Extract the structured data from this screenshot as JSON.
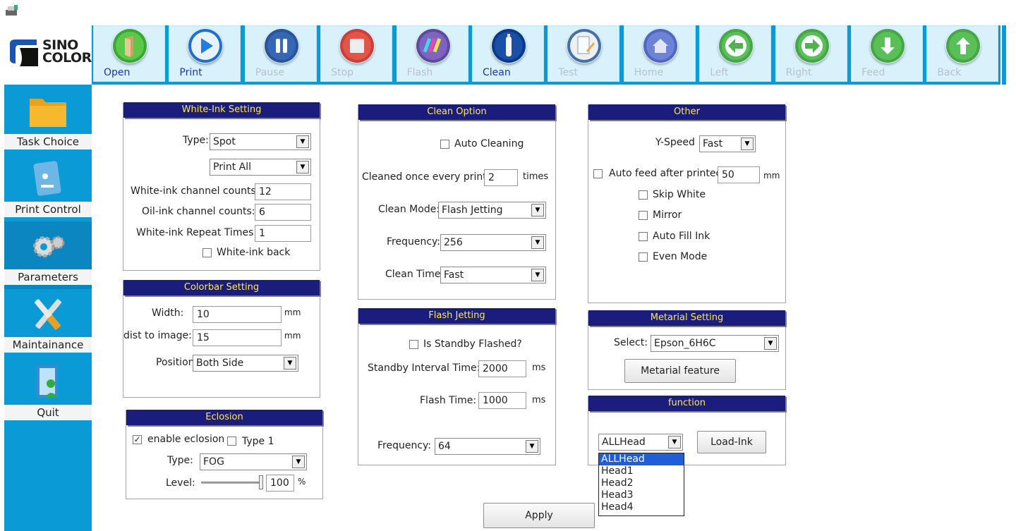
{
  "brand": {
    "logo_line1": "SINO",
    "logo_line2": "COLOR"
  },
  "toolbar": [
    {
      "label": "Open",
      "icon": "open-icon",
      "enabled": true
    },
    {
      "label": "Print",
      "icon": "print-icon",
      "enabled": true
    },
    {
      "label": "Pause",
      "icon": "pause-icon",
      "enabled": false
    },
    {
      "label": "Stop",
      "icon": "stop-icon",
      "enabled": false
    },
    {
      "label": "Flash",
      "icon": "flash-icon",
      "enabled": false
    },
    {
      "label": "Clean",
      "icon": "clean-icon",
      "enabled": true
    },
    {
      "label": "Test",
      "icon": "test-icon",
      "enabled": false
    },
    {
      "label": "Home",
      "icon": "home-icon",
      "enabled": false
    },
    {
      "label": "Left",
      "icon": "arrow-left-icon",
      "enabled": false
    },
    {
      "label": "Right",
      "icon": "arrow-right-icon",
      "enabled": false
    },
    {
      "label": "Feed",
      "icon": "arrow-down-icon",
      "enabled": false
    },
    {
      "label": "Back",
      "icon": "arrow-up-icon",
      "enabled": false
    }
  ],
  "sidebar": [
    {
      "label": "Task Choice",
      "icon": "folder-icon"
    },
    {
      "label": "Print Control",
      "icon": "print-control-icon"
    },
    {
      "label": "Parameters",
      "icon": "gears-icon"
    },
    {
      "label": "Maintainance",
      "icon": "tools-icon"
    },
    {
      "label": "Quit",
      "icon": "quit-icon"
    }
  ],
  "white_ink": {
    "title": "White-Ink Setting",
    "type_label": "Type:",
    "type_value": "Spot",
    "mode_value": "Print All",
    "white_channels_label": "White-ink channel counts:",
    "white_channels_value": "12",
    "oil_channels_label": "Oil-ink channel counts:",
    "oil_channels_value": "6",
    "repeat_label": "White-ink Repeat Times:",
    "repeat_value": "1",
    "back_label": "White-ink back",
    "back_checked": false
  },
  "colorbar": {
    "title": "Colorbar Setting",
    "width_label": "Width:",
    "width_value": "10",
    "width_unit": "mm",
    "dist_label": "dist to image:",
    "dist_value": "15",
    "dist_unit": "mm",
    "position_label": "Position",
    "position_value": "Both Side"
  },
  "eclosion": {
    "title": "Eclosion",
    "enable_label": "enable eclosion",
    "enable_checked": true,
    "type1_label": "Type 1",
    "type1_checked": false,
    "type_label": "Type:",
    "type_value": "FOG",
    "level_label": "Level:",
    "level_value": "100",
    "level_unit": "%",
    "level_fraction": 1.0
  },
  "clean_option": {
    "title": "Clean Option",
    "auto_label": "Auto Cleaning",
    "auto_checked": false,
    "every_label": "Cleaned once every print:",
    "every_value": "2",
    "every_unit": "times",
    "mode_label": "Clean Mode:",
    "mode_value": "Flash Jetting",
    "freq_label": "Frequency:",
    "freq_value": "256",
    "time_label": "Clean Time:",
    "time_value": "Fast"
  },
  "flash_jetting": {
    "title": "Flash Jetting",
    "standby_label": "Is Standby Flashed?",
    "standby_checked": false,
    "interval_label": "Standby Interval Time:",
    "interval_value": "2000",
    "interval_unit": "ms",
    "flash_label": "Flash Time:",
    "flash_value": "1000",
    "flash_unit": "ms",
    "freq_label": "Frequency:",
    "freq_value": "64"
  },
  "other": {
    "title": "Other",
    "yspeed_label": "Y-Speed",
    "yspeed_value": "Fast",
    "autofeed_label": "Auto feed after printed:",
    "autofeed_value": "50",
    "autofeed_unit": "mm",
    "autofeed_checked": false,
    "skip_white_label": "Skip White",
    "mirror_label": "Mirror",
    "auto_fill_label": "Auto Fill Ink",
    "even_mode_label": "Even Mode"
  },
  "material": {
    "title": "Metarial Setting",
    "select_label": "Select:",
    "select_value": "Epson_6H6C",
    "feature_button": "Metarial feature"
  },
  "function": {
    "title": "function",
    "head_value": "ALLHead",
    "load_ink_button": "Load-Ink",
    "head_options": [
      "ALLHead",
      "Head1",
      "Head2",
      "Head3",
      "Head4"
    ]
  },
  "apply_button": "Apply",
  "colors": {
    "accent": "#0a9ad6",
    "title_bar": "#1b1d7c",
    "title_text": "#ffe84c",
    "enabled_label": "#1a34b8",
    "disabled_label": "#b8c2c8"
  }
}
